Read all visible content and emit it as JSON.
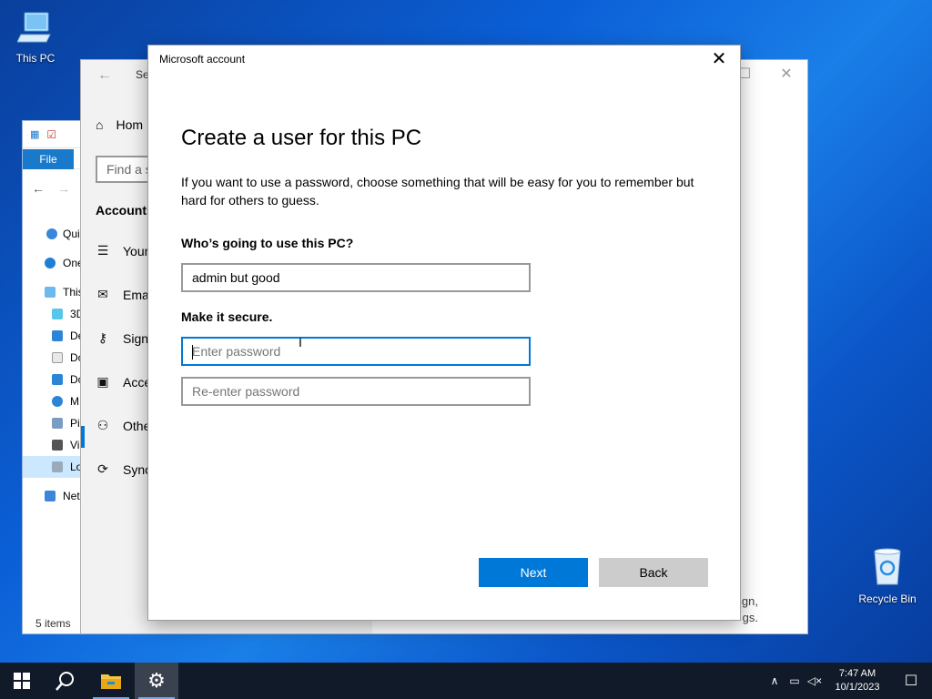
{
  "desktop": {
    "this_pc": "This PC",
    "recycle_bin": "Recycle Bin"
  },
  "explorer": {
    "file_tab": "File",
    "tree": [
      "Qui",
      "One",
      "This",
      "3D",
      "De",
      "Do",
      "Do",
      "M",
      "Pi",
      "Vi",
      "Lo",
      "Net"
    ],
    "status": "5 items"
  },
  "settings": {
    "title_fragment": "Se",
    "home": "Hom",
    "search_placeholder": "Find a s",
    "section": "Accounts",
    "nav": [
      "Your",
      "Ema",
      "Sign",
      "Acce",
      "Othe",
      "Sync"
    ],
    "footer_line1": "gn,",
    "footer_line2": "gs."
  },
  "dialog": {
    "window_title": "Microsoft account",
    "heading": "Create a user for this PC",
    "description": "If you want to use a password, choose something that will be easy for you to remember but hard for others to guess.",
    "who_label": "Who’s going to use this PC?",
    "username_value": "admin but good",
    "secure_label": "Make it secure.",
    "password_placeholder": "Enter password",
    "reenter_placeholder": "Re-enter password",
    "next_label": "Next",
    "back_label": "Back"
  },
  "taskbar": {
    "time": "7:47 AM",
    "date": "10/1/2023"
  },
  "colors": {
    "accent": "#0078d7",
    "taskbar": "#101a28"
  }
}
